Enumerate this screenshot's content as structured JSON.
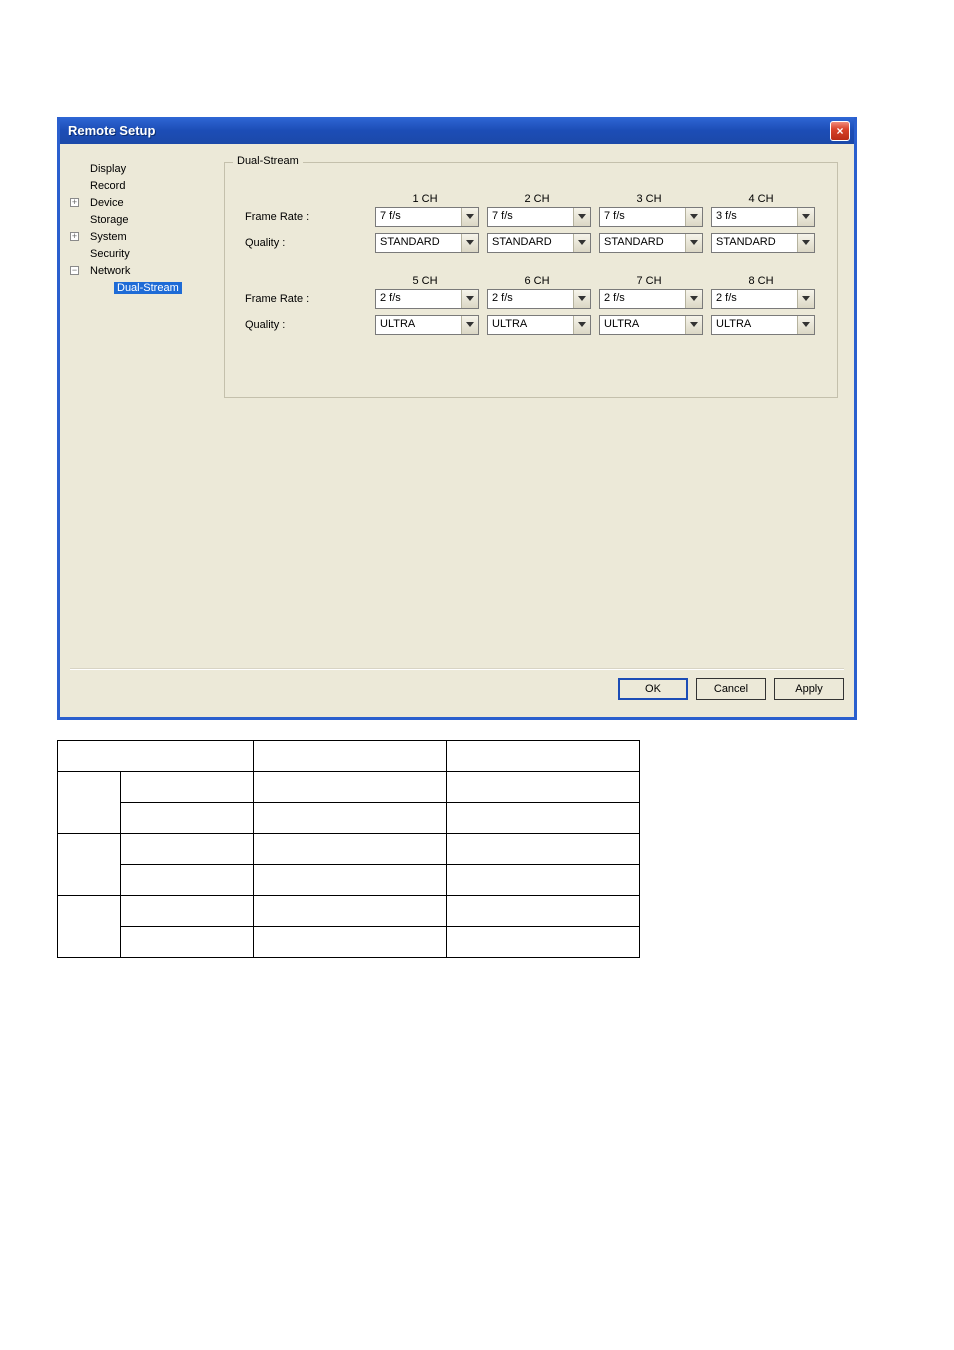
{
  "dialog": {
    "title": "Remote Setup",
    "close_label": "×"
  },
  "tree": {
    "items": [
      {
        "label": "Display"
      },
      {
        "label": "Record"
      },
      {
        "label": "Device",
        "expander": "+"
      },
      {
        "label": "Storage"
      },
      {
        "label": "System",
        "expander": "+"
      },
      {
        "label": "Security"
      },
      {
        "label": "Network",
        "expander": "−",
        "children": [
          {
            "label": "Dual-Stream",
            "selected": true
          }
        ]
      }
    ]
  },
  "panel": {
    "legend": "Dual-Stream",
    "groups": [
      {
        "headers": [
          "1 CH",
          "2 CH",
          "3 CH",
          "4 CH"
        ],
        "rows": [
          {
            "label": "Frame Rate :",
            "values": [
              "7 f/s",
              "7 f/s",
              "7 f/s",
              "3 f/s"
            ]
          },
          {
            "label": "Quality :",
            "values": [
              "STANDARD",
              "STANDARD",
              "STANDARD",
              "STANDARD"
            ]
          }
        ]
      },
      {
        "headers": [
          "5 CH",
          "6 CH",
          "7 CH",
          "8 CH"
        ],
        "rows": [
          {
            "label": "Frame Rate :",
            "values": [
              "2 f/s",
              "2 f/s",
              "2 f/s",
              "2 f/s"
            ]
          },
          {
            "label": "Quality :",
            "values": [
              "ULTRA",
              "ULTRA",
              "ULTRA",
              "ULTRA"
            ]
          }
        ]
      }
    ]
  },
  "buttons": {
    "ok": "OK",
    "cancel": "Cancel",
    "apply": "Apply"
  },
  "lower_table": {
    "rows": [
      [
        {
          "colspan": 2,
          "text": ""
        },
        {
          "text": ""
        },
        {
          "text": ""
        }
      ],
      [
        {
          "rowspan": 2,
          "text": ""
        },
        {
          "text": ""
        },
        {
          "text": ""
        },
        {
          "text": ""
        }
      ],
      [
        {
          "text": ""
        },
        {
          "text": ""
        },
        {
          "text": ""
        }
      ],
      [
        {
          "rowspan": 2,
          "text": ""
        },
        {
          "text": ""
        },
        {
          "text": ""
        },
        {
          "text": ""
        }
      ],
      [
        {
          "text": ""
        },
        {
          "text": ""
        },
        {
          "text": ""
        }
      ],
      [
        {
          "rowspan": 2,
          "text": ""
        },
        {
          "text": ""
        },
        {
          "text": ""
        },
        {
          "text": ""
        }
      ],
      [
        {
          "text": ""
        },
        {
          "text": ""
        },
        {
          "text": ""
        }
      ]
    ]
  }
}
